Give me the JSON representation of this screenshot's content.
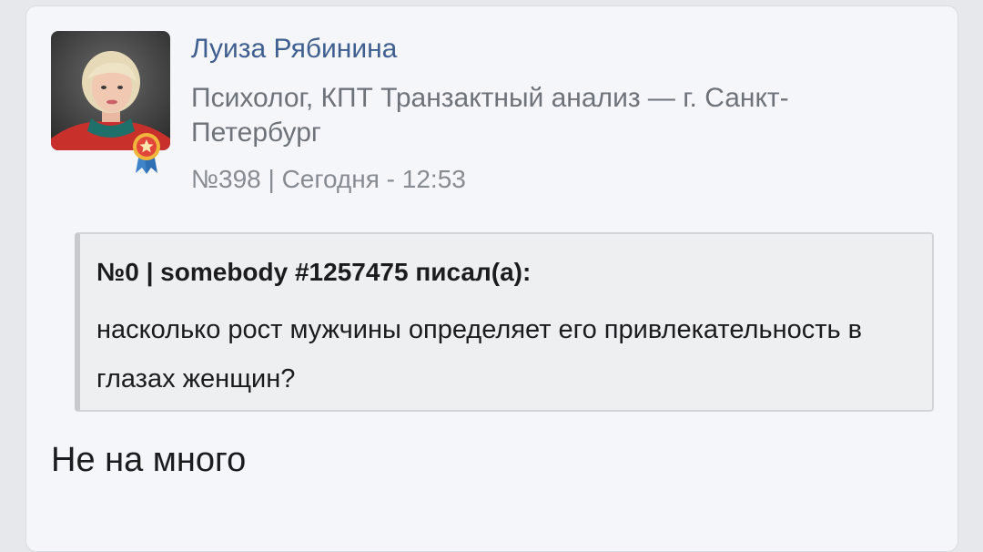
{
  "post": {
    "author": {
      "name": "Луиза Рябинина",
      "title": "Психолог, КПТ Транзактный анализ — г. Санкт-Петербург",
      "avatar_icon": "user-avatar",
      "badge_icon": "award-ribbon-icon"
    },
    "meta": "№398 | Сегодня - 12:53",
    "quote": {
      "header": "№0 | somebody #1257475 писал(а):",
      "text": "насколько рост мужчины определяет его привлекательность в глазах женщин?"
    },
    "reply": "Не на много"
  },
  "colors": {
    "name": "#3e5f8f",
    "secondary_text": "#6e737a",
    "card_background": "#f4f6f9",
    "quote_background": "#eeeff1"
  }
}
